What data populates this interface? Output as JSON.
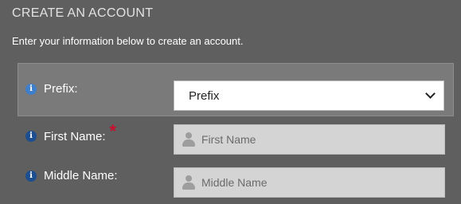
{
  "header": {
    "title": "CREATE AN ACCOUNT",
    "intro": "Enter your information below to create an account."
  },
  "form": {
    "prefix": {
      "label": "Prefix:",
      "selected": "Prefix"
    },
    "first_name": {
      "label": "First Name:",
      "required_mark": "*",
      "placeholder": "First Name"
    },
    "middle_name": {
      "label": "Middle Name:",
      "placeholder": "Middle Name"
    }
  },
  "icons": {
    "info": "info-icon",
    "person": "person-icon",
    "chevron": "chevron-down-icon"
  },
  "colors": {
    "background": "#5f5f5f",
    "highlight_row": "#7a7a7a",
    "required": "#c8102e",
    "info_icon": "#1d4e8f"
  }
}
